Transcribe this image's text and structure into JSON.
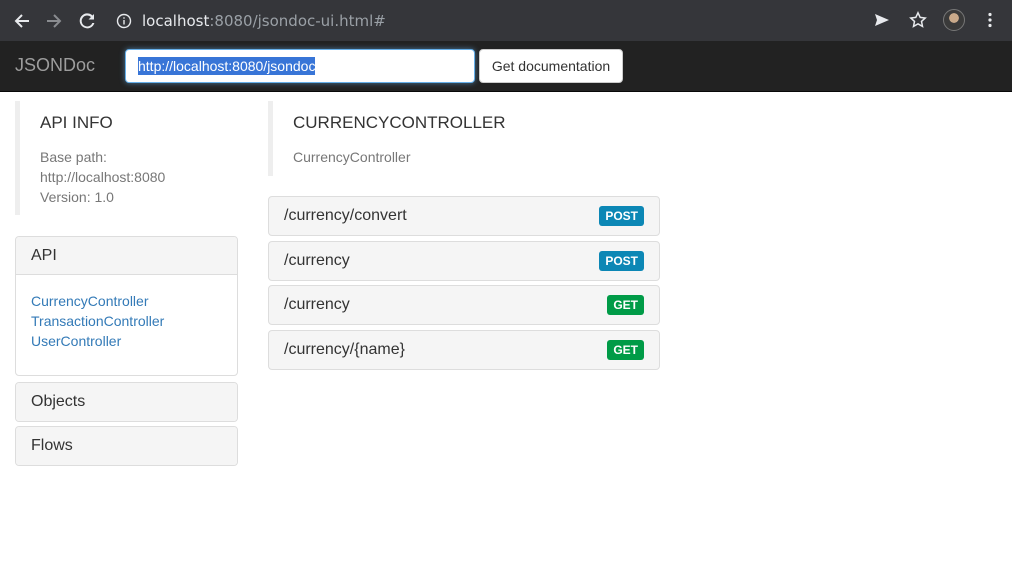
{
  "browser": {
    "url_host": "localhost",
    "url_rest": ":8080/jsondoc-ui.html#"
  },
  "navbar": {
    "brand": "JSONDoc",
    "url_value": "http://localhost:8080/jsondoc",
    "get_button": "Get documentation"
  },
  "api_info": {
    "title": "API INFO",
    "base_path_label": "Base path:",
    "base_path": "http://localhost:8080",
    "version": "Version: 1.0"
  },
  "sidebar": {
    "api": {
      "title": "API",
      "items": [
        "CurrencyController",
        "TransactionController",
        "UserController"
      ]
    },
    "objects": {
      "title": "Objects"
    },
    "flows": {
      "title": "Flows"
    }
  },
  "controller": {
    "title": "CURRENCYCONTROLLER",
    "description": "CurrencyController"
  },
  "methods": [
    {
      "path": "/currency/convert",
      "verb": "POST"
    },
    {
      "path": "/currency",
      "verb": "POST"
    },
    {
      "path": "/currency",
      "verb": "GET"
    },
    {
      "path": "/currency/{name}",
      "verb": "GET"
    }
  ],
  "colors": {
    "post": "#0c87b5",
    "get": "#009b47",
    "link": "#337ab7"
  }
}
